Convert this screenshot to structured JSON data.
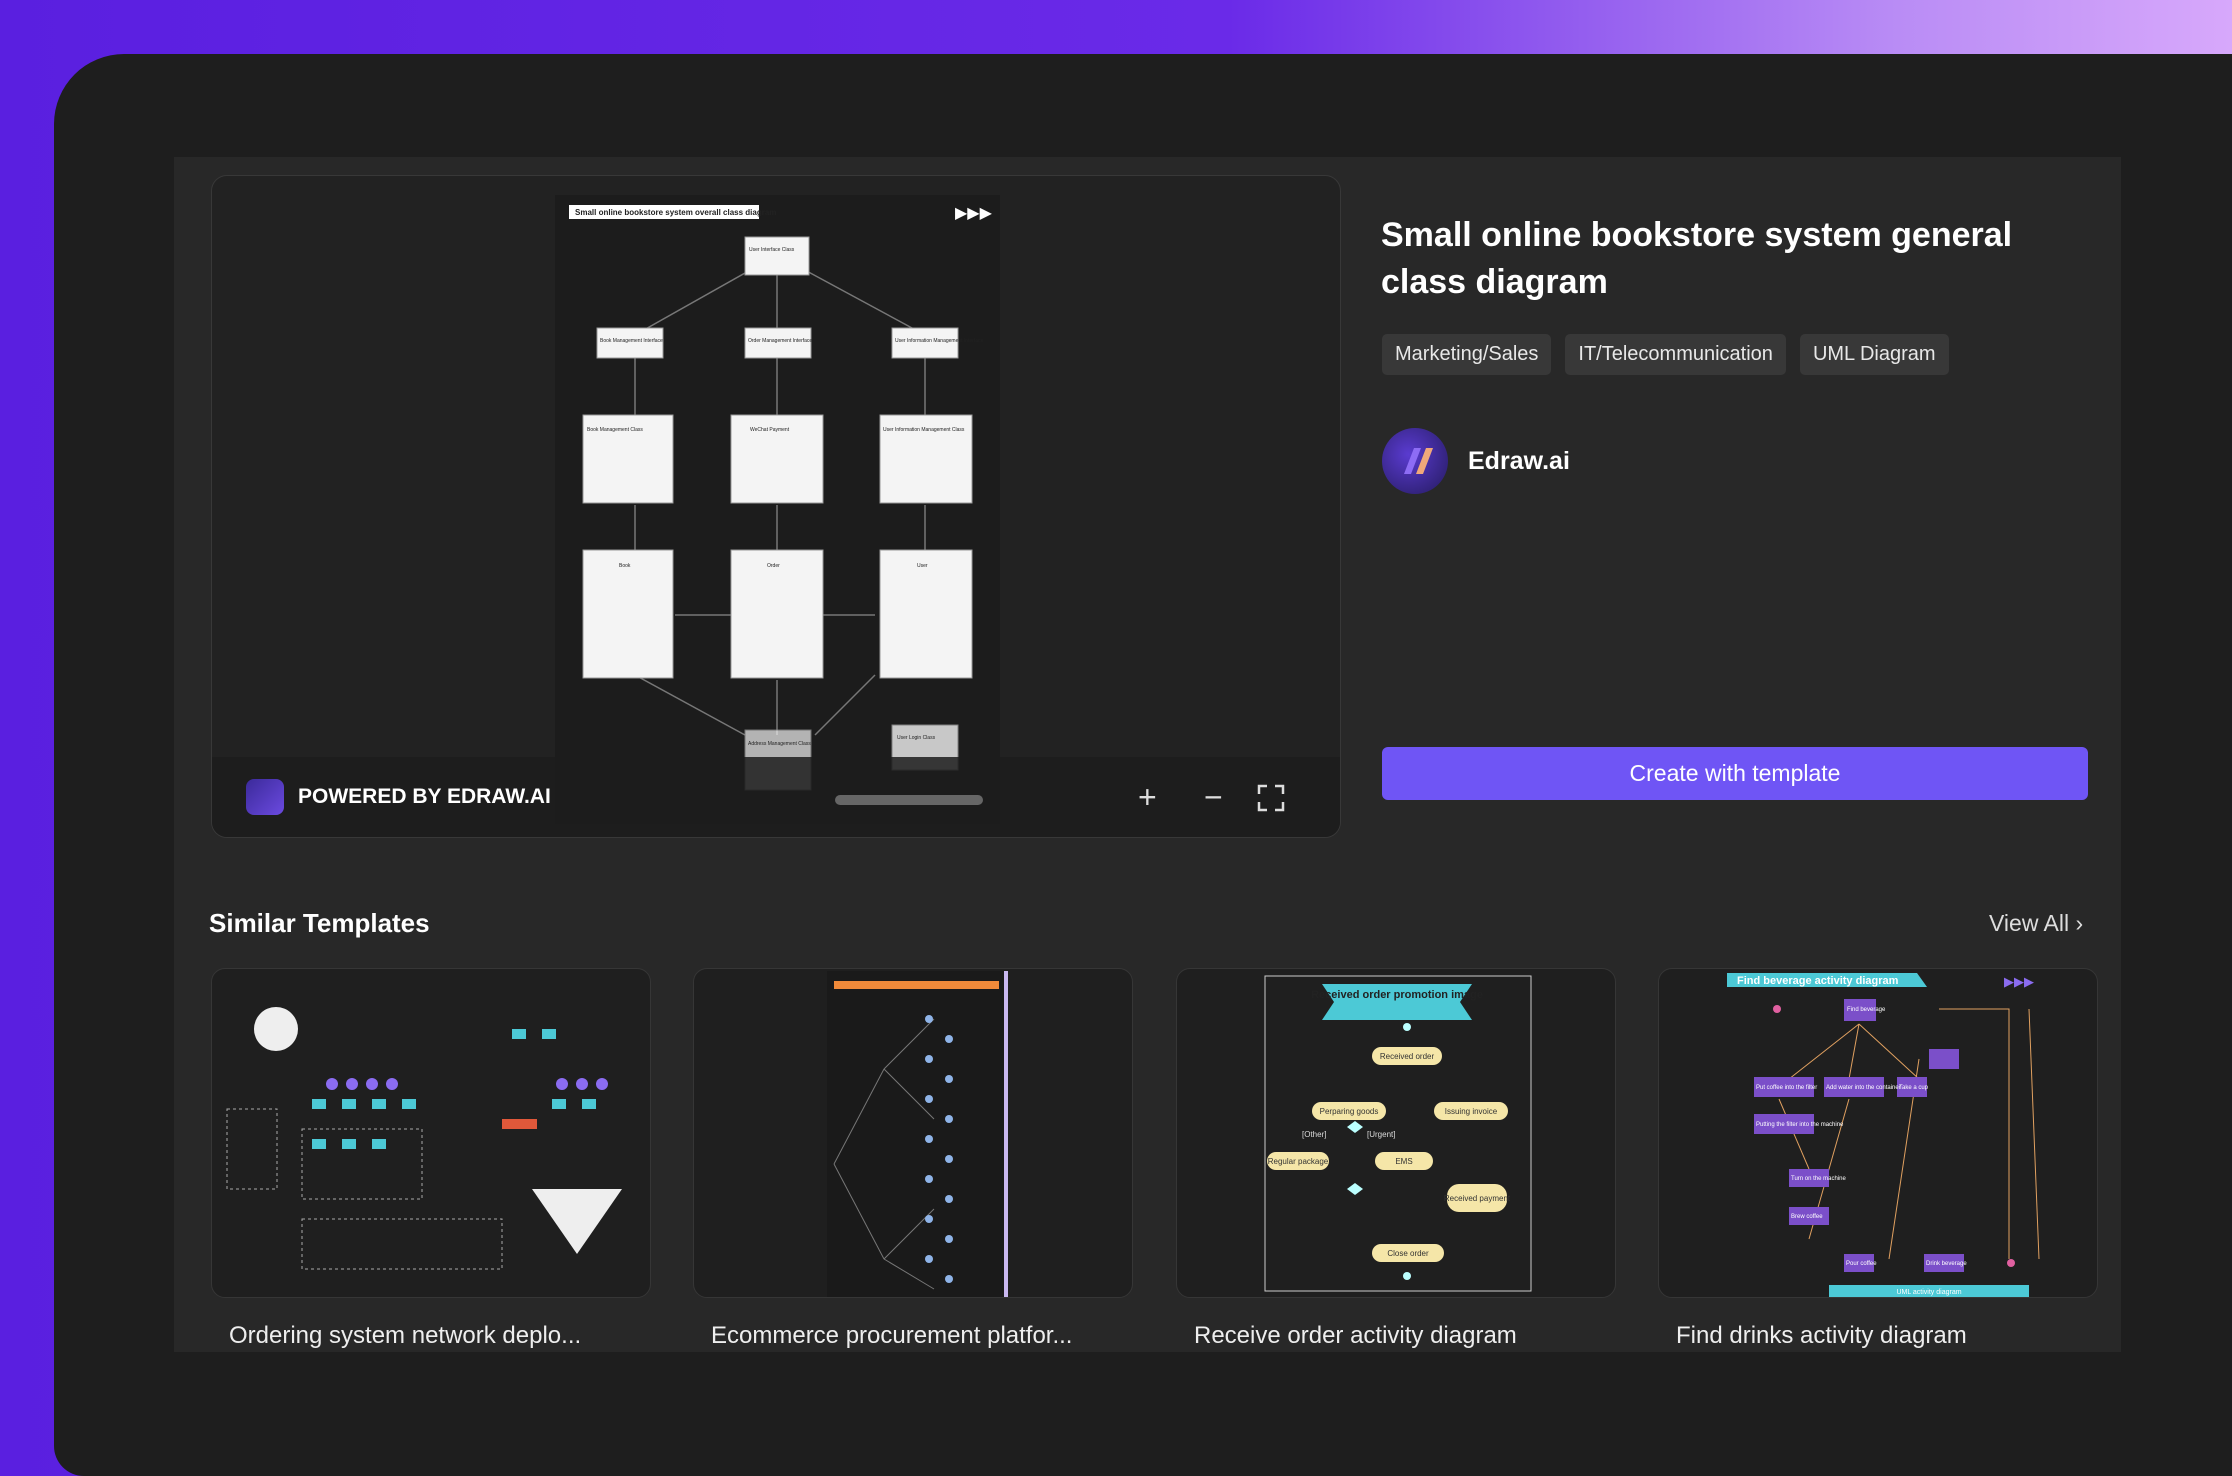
{
  "preview": {
    "diagram_title": "Small online bookstore system overall class diagram",
    "boxes": [
      "User Interface Class",
      "Book Management Interface",
      "Order Management Interface",
      "User Information Management Interface",
      "Book Management Class",
      "WeChat Payment",
      "User Information Management Class",
      "Book",
      "Order",
      "User",
      "Address Management Class",
      "User Login Class"
    ],
    "powered_by": "POWERED BY EDRAW.AI",
    "zoom_in": "+",
    "zoom_out": "−"
  },
  "detail": {
    "title": "Small online bookstore system general class diagram",
    "tags": [
      "Marketing/Sales",
      "IT/Telecommunication",
      "UML Diagram"
    ],
    "author": "Edraw.ai",
    "create_button": "Create with template"
  },
  "similar": {
    "heading": "Similar Templates",
    "view_all": "View All",
    "cards": [
      {
        "caption": "Ordering system network deplo..."
      },
      {
        "caption": "Ecommerce procurement platfor..."
      },
      {
        "caption": "Receive order activity diagram",
        "labels": [
          "Received order promotion image",
          "Received order",
          "Perparing goods",
          "Issuing invoice",
          "[Other]",
          "[Urgent]",
          "Regular package",
          "EMS",
          "Received payment",
          "Close order"
        ]
      },
      {
        "caption": "Find drinks activity diagram",
        "labels": [
          "Find beverage activity diagram",
          "Find beverage",
          "Put coffee into the filter",
          "Add water into the container",
          "Take a cup",
          "Putting the filter into the machine",
          "Turn on the machine",
          "Brew coffee",
          "Pour coffee",
          "Drink beverage",
          "UML activity diagram"
        ]
      }
    ]
  },
  "colors": {
    "accent": "#6f55f5",
    "teal": "#4cc9d6",
    "purple_node": "#7b4fc9"
  }
}
